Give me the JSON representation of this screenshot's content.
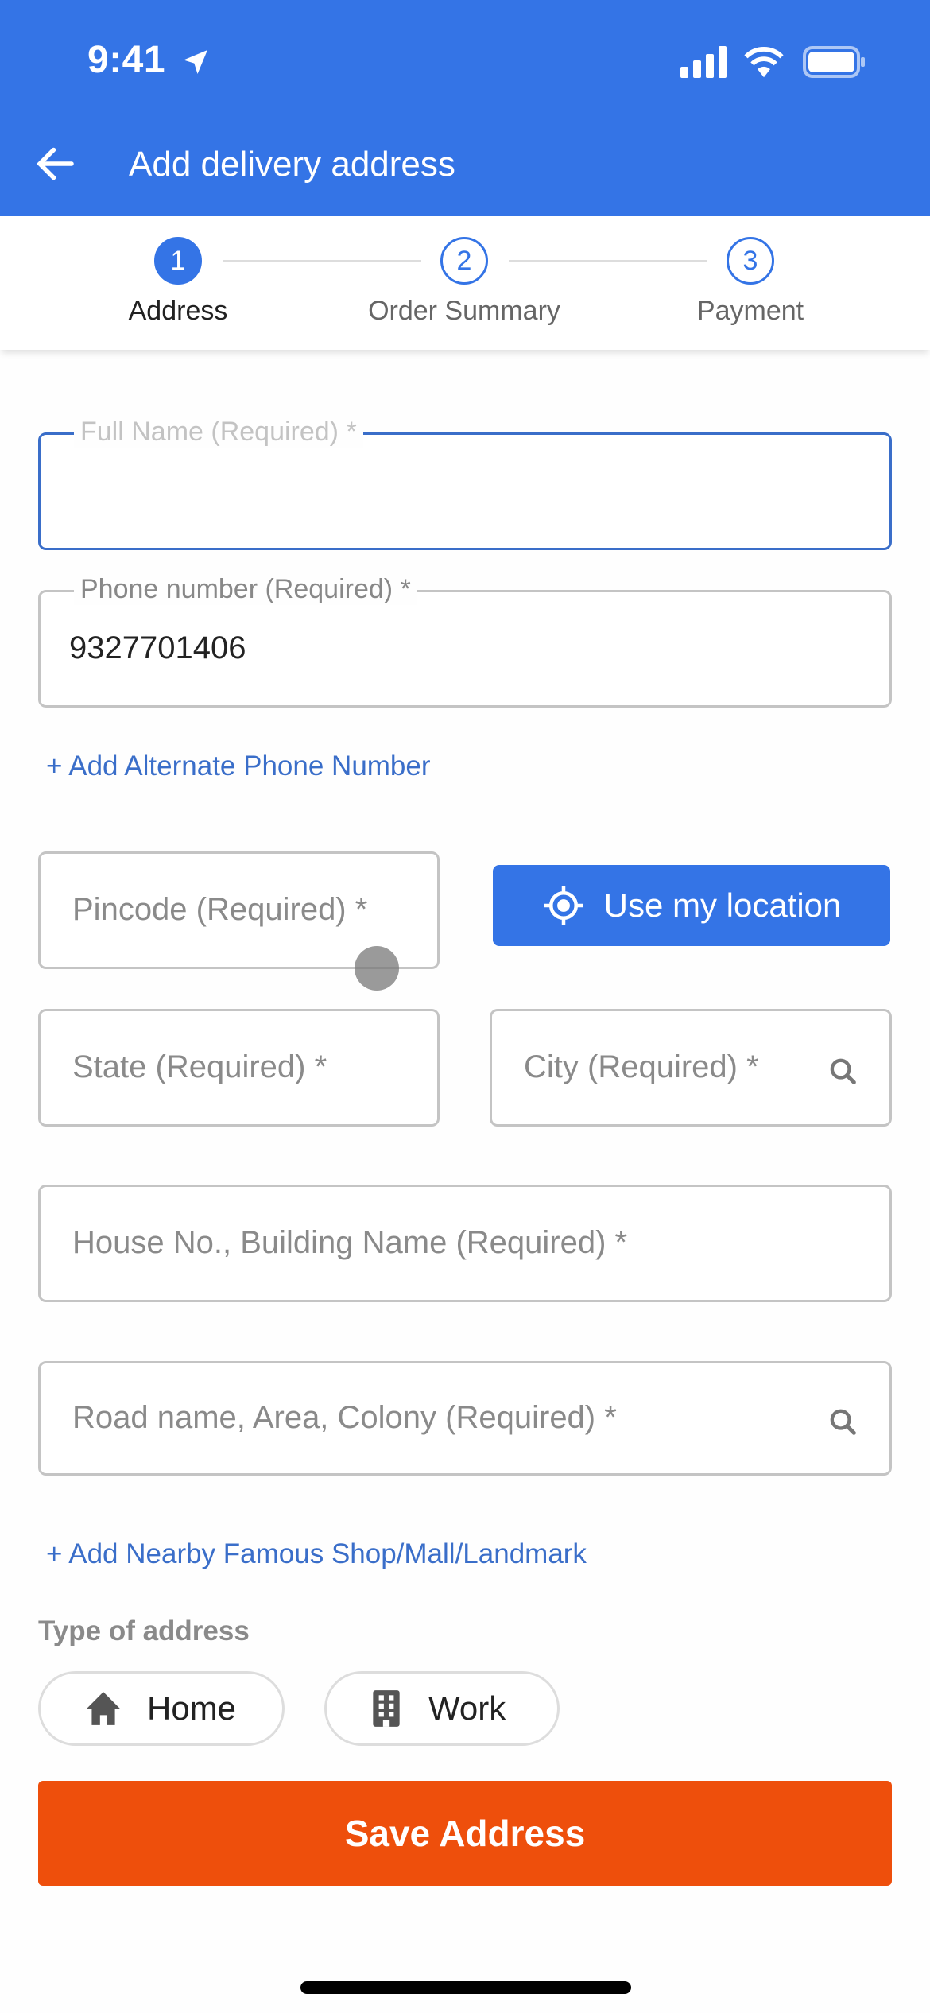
{
  "status_bar": {
    "time": "9:41"
  },
  "header": {
    "title": "Add delivery address",
    "back_icon": "arrow-left-icon"
  },
  "stepper": {
    "steps": [
      {
        "number": "1",
        "label": "Address",
        "active": true
      },
      {
        "number": "2",
        "label": "Order Summary",
        "active": false
      },
      {
        "number": "3",
        "label": "Payment",
        "active": false
      }
    ]
  },
  "form": {
    "full_name": {
      "label": "Full Name (Required) *",
      "value": ""
    },
    "phone": {
      "label": "Phone number (Required) *",
      "value": "9327701406"
    },
    "add_alternate_phone": "+ Add Alternate Phone Number",
    "pincode": {
      "placeholder": "Pincode (Required) *"
    },
    "use_location": "Use my location",
    "state": {
      "placeholder": "State (Required) *"
    },
    "city": {
      "placeholder": "City (Required) *"
    },
    "house": {
      "placeholder": "House No., Building Name (Required) *"
    },
    "road": {
      "placeholder": "Road name, Area, Colony (Required) *"
    },
    "add_landmark": "+ Add Nearby Famous Shop/Mall/Landmark",
    "address_type": {
      "label": "Type of address",
      "options": [
        {
          "label": "Home",
          "icon": "home-icon"
        },
        {
          "label": "Work",
          "icon": "building-icon"
        }
      ]
    },
    "save_button": "Save Address"
  },
  "colors": {
    "primary": "#3474e6",
    "save": "#ee4f0c",
    "link": "#3a6ec9"
  }
}
